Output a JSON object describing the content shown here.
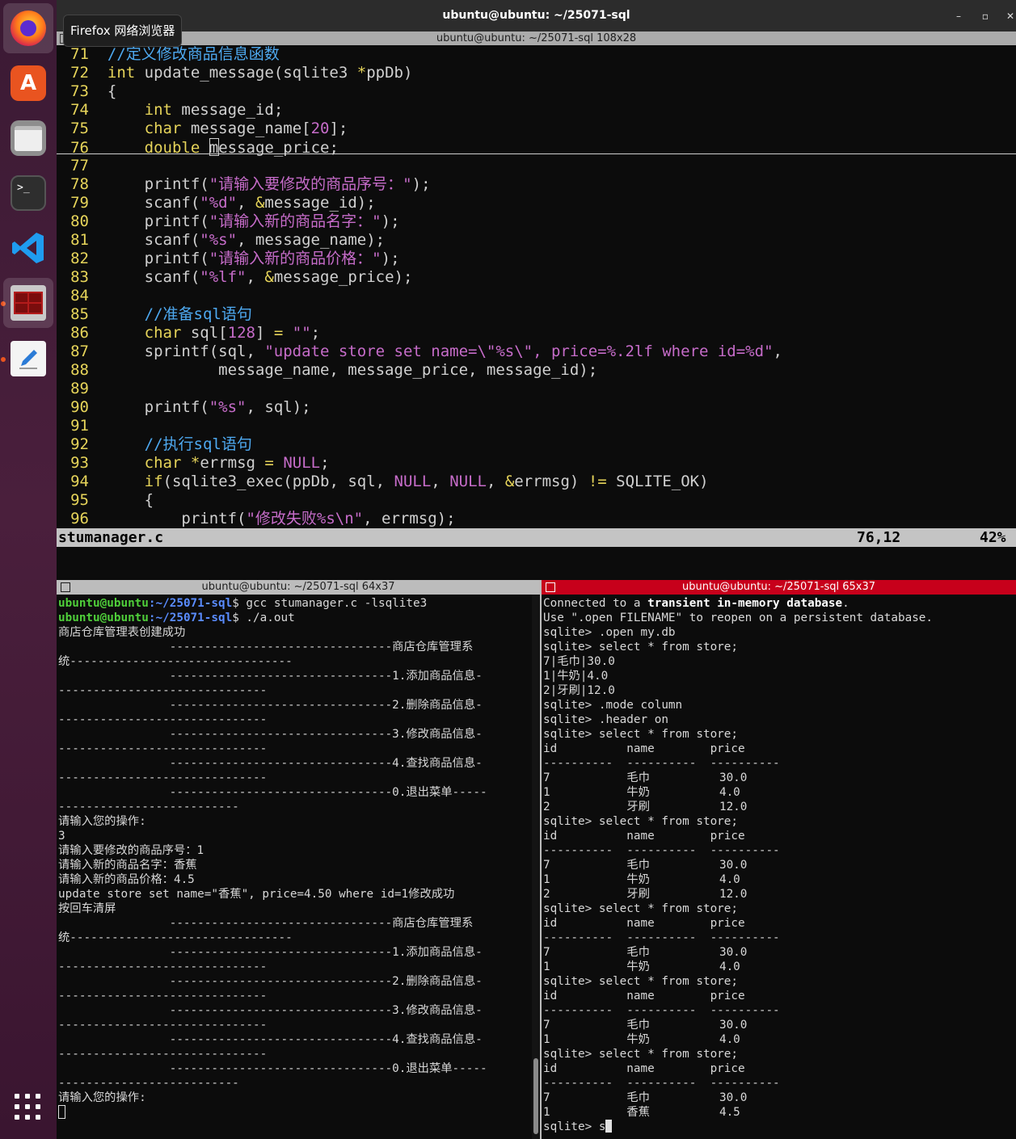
{
  "dock": {
    "tooltip": "Firefox 网络浏览器",
    "items": [
      {
        "name": "firefox-icon"
      },
      {
        "name": "software-center-icon",
        "glyph": "A"
      },
      {
        "name": "files-icon"
      },
      {
        "name": "terminal-icon",
        "glyph": ">_"
      },
      {
        "name": "vscode-icon"
      },
      {
        "name": "terminator-icon"
      },
      {
        "name": "text-editor-icon"
      },
      {
        "name": "show-apps-icon"
      }
    ]
  },
  "window": {
    "title": "ubuntu@ubuntu: ~/25071-sql",
    "top_pane_title": "ubuntu@ubuntu: ~/25071-sql 108x28",
    "controls": {
      "minimize": "–",
      "maximize": "▫",
      "close": "✕"
    }
  },
  "editor": {
    "lines": [
      {
        "n": "71",
        "segs": [
          {
            "t": "//定义修改商品信息函数",
            "c": "cm"
          }
        ]
      },
      {
        "n": "72",
        "segs": [
          {
            "t": "int",
            "c": "ty"
          },
          {
            "t": " update_message(sqlite3 ",
            "c": "pu"
          },
          {
            "t": "*",
            "c": "kw"
          },
          {
            "t": "ppDb)",
            "c": "pu"
          }
        ]
      },
      {
        "n": "73",
        "segs": [
          {
            "t": "{",
            "c": "pu"
          }
        ]
      },
      {
        "n": "74",
        "segs": [
          {
            "t": "    ",
            "c": "pu"
          },
          {
            "t": "int",
            "c": "ty"
          },
          {
            "t": " message_id;",
            "c": "pu"
          }
        ]
      },
      {
        "n": "75",
        "segs": [
          {
            "t": "    ",
            "c": "pu"
          },
          {
            "t": "char",
            "c": "ty"
          },
          {
            "t": " message_name[",
            "c": "pu"
          },
          {
            "t": "20",
            "c": "nm"
          },
          {
            "t": "];",
            "c": "pu"
          }
        ]
      },
      {
        "n": "76",
        "segs": [
          {
            "t": "    ",
            "c": "pu"
          },
          {
            "t": "double",
            "c": "ty"
          },
          {
            "t": " ",
            "c": "pu"
          },
          {
            "t": "CURSOR",
            "c": "cur"
          },
          {
            "t": "message_price;",
            "c": "pu"
          }
        ]
      },
      {
        "n": "77",
        "segs": []
      },
      {
        "n": "78",
        "segs": [
          {
            "t": "    printf(",
            "c": "pu"
          },
          {
            "t": "\"请输入要修改的商品序号：\"",
            "c": "st"
          },
          {
            "t": ");",
            "c": "pu"
          }
        ]
      },
      {
        "n": "79",
        "segs": [
          {
            "t": "    scanf(",
            "c": "pu"
          },
          {
            "t": "\"%d\"",
            "c": "st"
          },
          {
            "t": ", ",
            "c": "pu"
          },
          {
            "t": "&",
            "c": "kw"
          },
          {
            "t": "message_id);",
            "c": "pu"
          }
        ]
      },
      {
        "n": "80",
        "segs": [
          {
            "t": "    printf(",
            "c": "pu"
          },
          {
            "t": "\"请输入新的商品名字：\"",
            "c": "st"
          },
          {
            "t": ");",
            "c": "pu"
          }
        ]
      },
      {
        "n": "81",
        "segs": [
          {
            "t": "    scanf(",
            "c": "pu"
          },
          {
            "t": "\"%s\"",
            "c": "st"
          },
          {
            "t": ", message_name);",
            "c": "pu"
          }
        ]
      },
      {
        "n": "82",
        "segs": [
          {
            "t": "    printf(",
            "c": "pu"
          },
          {
            "t": "\"请输入新的商品价格：\"",
            "c": "st"
          },
          {
            "t": ");",
            "c": "pu"
          }
        ]
      },
      {
        "n": "83",
        "segs": [
          {
            "t": "    scanf(",
            "c": "pu"
          },
          {
            "t": "\"%lf\"",
            "c": "st"
          },
          {
            "t": ", ",
            "c": "pu"
          },
          {
            "t": "&",
            "c": "kw"
          },
          {
            "t": "message_price);",
            "c": "pu"
          }
        ]
      },
      {
        "n": "84",
        "segs": []
      },
      {
        "n": "85",
        "segs": [
          {
            "t": "    ",
            "c": "pu"
          },
          {
            "t": "//准备sql语句",
            "c": "cm"
          }
        ]
      },
      {
        "n": "86",
        "segs": [
          {
            "t": "    ",
            "c": "pu"
          },
          {
            "t": "char",
            "c": "ty"
          },
          {
            "t": " sql[",
            "c": "pu"
          },
          {
            "t": "128",
            "c": "nm"
          },
          {
            "t": "] ",
            "c": "pu"
          },
          {
            "t": "=",
            "c": "kw"
          },
          {
            "t": " ",
            "c": "pu"
          },
          {
            "t": "\"\"",
            "c": "st"
          },
          {
            "t": ";",
            "c": "pu"
          }
        ]
      },
      {
        "n": "87",
        "segs": [
          {
            "t": "    sprintf(sql, ",
            "c": "pu"
          },
          {
            "t": "\"update store set name=\\\"%s\\\", price=%.2lf where id=%d\"",
            "c": "st"
          },
          {
            "t": ",",
            "c": "pu"
          }
        ]
      },
      {
        "n": "88",
        "segs": [
          {
            "t": "            message_name, message_price, message_id);",
            "c": "pu"
          }
        ]
      },
      {
        "n": "89",
        "segs": []
      },
      {
        "n": "90",
        "segs": [
          {
            "t": "    printf(",
            "c": "pu"
          },
          {
            "t": "\"%s\"",
            "c": "st"
          },
          {
            "t": ", sql);",
            "c": "pu"
          }
        ]
      },
      {
        "n": "91",
        "segs": []
      },
      {
        "n": "92",
        "segs": [
          {
            "t": "    ",
            "c": "pu"
          },
          {
            "t": "//执行sql语句",
            "c": "cm"
          }
        ]
      },
      {
        "n": "93",
        "segs": [
          {
            "t": "    ",
            "c": "pu"
          },
          {
            "t": "char",
            "c": "ty"
          },
          {
            "t": " ",
            "c": "pu"
          },
          {
            "t": "*",
            "c": "kw"
          },
          {
            "t": "errmsg ",
            "c": "pu"
          },
          {
            "t": "=",
            "c": "kw"
          },
          {
            "t": " ",
            "c": "pu"
          },
          {
            "t": "NULL",
            "c": "nm"
          },
          {
            "t": ";",
            "c": "pu"
          }
        ]
      },
      {
        "n": "94",
        "segs": [
          {
            "t": "    ",
            "c": "pu"
          },
          {
            "t": "if",
            "c": "ty"
          },
          {
            "t": "(sqlite3_exec(ppDb, sql, ",
            "c": "pu"
          },
          {
            "t": "NULL",
            "c": "nm"
          },
          {
            "t": ", ",
            "c": "pu"
          },
          {
            "t": "NULL",
            "c": "nm"
          },
          {
            "t": ", ",
            "c": "pu"
          },
          {
            "t": "&",
            "c": "kw"
          },
          {
            "t": "errmsg) ",
            "c": "pu"
          },
          {
            "t": "!=",
            "c": "kw"
          },
          {
            "t": " SQLITE_OK)",
            "c": "pu"
          }
        ]
      },
      {
        "n": "95",
        "segs": [
          {
            "t": "    {",
            "c": "pu"
          }
        ]
      },
      {
        "n": "96",
        "segs": [
          {
            "t": "        printf(",
            "c": "pu"
          },
          {
            "t": "\"修改失败%s\\n\"",
            "c": "st"
          },
          {
            "t": ", errmsg);",
            "c": "pu"
          }
        ]
      }
    ],
    "status": {
      "filename": "stumanager.c",
      "position": "76,12",
      "percent": "42%"
    }
  },
  "left_terminal": {
    "title": "ubuntu@ubuntu: ~/25071-sql 64x37",
    "prompt_user": "ubuntu@ubuntu",
    "prompt_path": ":~/25071-sql",
    "lines": [
      {
        "kind": "prompt",
        "cmd": "$ gcc stumanager.c -lsqlite3"
      },
      {
        "kind": "prompt",
        "cmd": "$ ./a.out"
      },
      {
        "kind": "text",
        "t": "商店仓库管理表创建成功"
      },
      {
        "kind": "text",
        "t": "                --------------------------------商店仓库管理系"
      },
      {
        "kind": "text",
        "t": "统--------------------------------"
      },
      {
        "kind": "text",
        "t": "                --------------------------------1.添加商品信息-"
      },
      {
        "kind": "text",
        "t": "------------------------------"
      },
      {
        "kind": "text",
        "t": "                --------------------------------2.删除商品信息-"
      },
      {
        "kind": "text",
        "t": "------------------------------"
      },
      {
        "kind": "text",
        "t": "                --------------------------------3.修改商品信息-"
      },
      {
        "kind": "text",
        "t": "------------------------------"
      },
      {
        "kind": "text",
        "t": "                --------------------------------4.查找商品信息-"
      },
      {
        "kind": "text",
        "t": "------------------------------"
      },
      {
        "kind": "text",
        "t": "                --------------------------------0.退出菜单-----"
      },
      {
        "kind": "text",
        "t": "--------------------------"
      },
      {
        "kind": "text",
        "t": "请输入您的操作:"
      },
      {
        "kind": "text",
        "t": "3"
      },
      {
        "kind": "text",
        "t": "请输入要修改的商品序号：1"
      },
      {
        "kind": "text",
        "t": "请输入新的商品名字：香蕉"
      },
      {
        "kind": "text",
        "t": "请输入新的商品价格：4.5"
      },
      {
        "kind": "text",
        "t": "update store set name=\"香蕉\", price=4.50 where id=1修改成功"
      },
      {
        "kind": "text",
        "t": "按回车清屏"
      },
      {
        "kind": "text",
        "t": "                --------------------------------商店仓库管理系"
      },
      {
        "kind": "text",
        "t": "统--------------------------------"
      },
      {
        "kind": "text",
        "t": "                --------------------------------1.添加商品信息-"
      },
      {
        "kind": "text",
        "t": "------------------------------"
      },
      {
        "kind": "text",
        "t": "                --------------------------------2.删除商品信息-"
      },
      {
        "kind": "text",
        "t": "------------------------------"
      },
      {
        "kind": "text",
        "t": "                --------------------------------3.修改商品信息-"
      },
      {
        "kind": "text",
        "t": "------------------------------"
      },
      {
        "kind": "text",
        "t": "                --------------------------------4.查找商品信息-"
      },
      {
        "kind": "text",
        "t": "------------------------------"
      },
      {
        "kind": "text",
        "t": "                --------------------------------0.退出菜单-----"
      },
      {
        "kind": "text",
        "t": "--------------------------"
      },
      {
        "kind": "text",
        "t": "请输入您的操作:"
      },
      {
        "kind": "cursor",
        "t": ""
      }
    ]
  },
  "right_terminal": {
    "title": "ubuntu@ubuntu: ~/25071-sql 65x37",
    "lines": [
      {
        "segs": [
          {
            "t": "Connected to a "
          },
          {
            "t": "transient in-memory database",
            "b": true
          },
          {
            "t": "."
          }
        ]
      },
      {
        "segs": [
          {
            "t": "Use \".open FILENAME\" to reopen on a persistent database."
          }
        ]
      },
      {
        "segs": [
          {
            "t": "sqlite> .open my.db"
          }
        ]
      },
      {
        "segs": [
          {
            "t": "sqlite> select * from store;"
          }
        ]
      },
      {
        "segs": [
          {
            "t": "7|毛巾|30.0"
          }
        ]
      },
      {
        "segs": [
          {
            "t": "1|牛奶|4.0"
          }
        ]
      },
      {
        "segs": [
          {
            "t": "2|牙刷|12.0"
          }
        ]
      },
      {
        "segs": [
          {
            "t": "sqlite> .mode column"
          }
        ]
      },
      {
        "segs": [
          {
            "t": "sqlite> .header on"
          }
        ]
      },
      {
        "segs": [
          {
            "t": "sqlite> select * from store;"
          }
        ]
      },
      {
        "segs": [
          {
            "t": "id          name        price"
          }
        ]
      },
      {
        "segs": [
          {
            "t": "----------  ----------  ----------"
          }
        ]
      },
      {
        "segs": [
          {
            "t": "7           毛巾          30.0"
          }
        ]
      },
      {
        "segs": [
          {
            "t": "1           牛奶          4.0"
          }
        ]
      },
      {
        "segs": [
          {
            "t": "2           牙刷          12.0"
          }
        ]
      },
      {
        "segs": [
          {
            "t": "sqlite> select * from store;"
          }
        ]
      },
      {
        "segs": [
          {
            "t": "id          name        price"
          }
        ]
      },
      {
        "segs": [
          {
            "t": "----------  ----------  ----------"
          }
        ]
      },
      {
        "segs": [
          {
            "t": "7           毛巾          30.0"
          }
        ]
      },
      {
        "segs": [
          {
            "t": "1           牛奶          4.0"
          }
        ]
      },
      {
        "segs": [
          {
            "t": "2           牙刷          12.0"
          }
        ]
      },
      {
        "segs": [
          {
            "t": "sqlite> select * from store;"
          }
        ]
      },
      {
        "segs": [
          {
            "t": "id          name        price"
          }
        ]
      },
      {
        "segs": [
          {
            "t": "----------  ----------  ----------"
          }
        ]
      },
      {
        "segs": [
          {
            "t": "7           毛巾          30.0"
          }
        ]
      },
      {
        "segs": [
          {
            "t": "1           牛奶          4.0"
          }
        ]
      },
      {
        "segs": [
          {
            "t": "sqlite> select * from store;"
          }
        ]
      },
      {
        "segs": [
          {
            "t": "id          name        price"
          }
        ]
      },
      {
        "segs": [
          {
            "t": "----------  ----------  ----------"
          }
        ]
      },
      {
        "segs": [
          {
            "t": "7           毛巾          30.0"
          }
        ]
      },
      {
        "segs": [
          {
            "t": "1           牛奶          4.0"
          }
        ]
      },
      {
        "segs": [
          {
            "t": "sqlite> select * from store;"
          }
        ]
      },
      {
        "segs": [
          {
            "t": "id          name        price"
          }
        ]
      },
      {
        "segs": [
          {
            "t": "----------  ----------  ----------"
          }
        ]
      },
      {
        "segs": [
          {
            "t": "7           毛巾          30.0"
          }
        ]
      },
      {
        "segs": [
          {
            "t": "1           香蕉          4.5"
          }
        ]
      },
      {
        "segs": [
          {
            "t": "sqlite> s"
          }
        ],
        "cursor": true
      }
    ]
  }
}
